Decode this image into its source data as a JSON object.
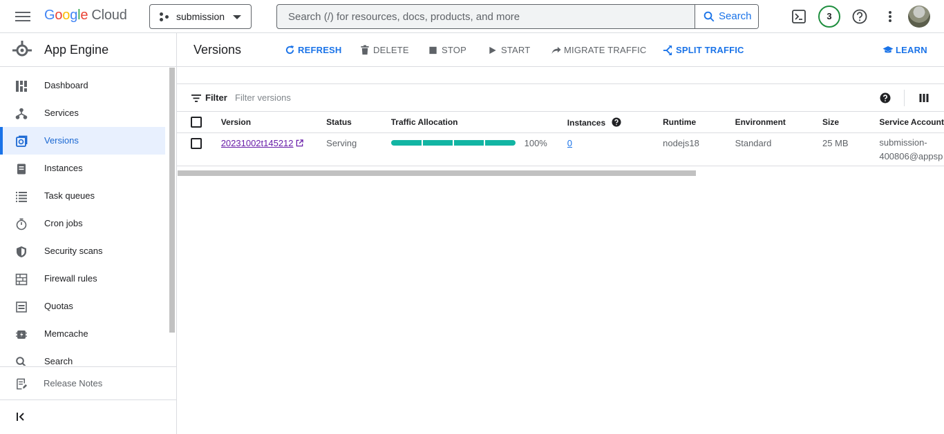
{
  "topbar": {
    "logo_text": "Google",
    "logo_cloud": "Cloud",
    "project_name": "submission",
    "search_placeholder": "Search (/) for resources, docs, products, and more",
    "search_button": "Search",
    "notification_count": "3",
    "icons": [
      "menu-icon",
      "project-dots-icon",
      "search-icon",
      "cloud-shell-icon",
      "help-icon",
      "more-vert-icon",
      "avatar"
    ]
  },
  "sidebar": {
    "product_title": "App Engine",
    "items": [
      {
        "label": "Dashboard",
        "icon": "dashboard-icon"
      },
      {
        "label": "Services",
        "icon": "services-icon"
      },
      {
        "label": "Versions",
        "icon": "versions-icon",
        "active": true
      },
      {
        "label": "Instances",
        "icon": "instances-icon"
      },
      {
        "label": "Task queues",
        "icon": "task-queues-icon"
      },
      {
        "label": "Cron jobs",
        "icon": "cron-jobs-icon"
      },
      {
        "label": "Security scans",
        "icon": "security-scans-icon"
      },
      {
        "label": "Firewall rules",
        "icon": "firewall-rules-icon"
      },
      {
        "label": "Quotas",
        "icon": "quotas-icon"
      },
      {
        "label": "Memcache",
        "icon": "memcache-icon"
      },
      {
        "label": "Search",
        "icon": "search-icon"
      }
    ],
    "release_notes": "Release Notes"
  },
  "toolbar": {
    "title": "Versions",
    "refresh": "REFRESH",
    "delete": "DELETE",
    "stop": "STOP",
    "start": "START",
    "migrate": "MIGRATE TRAFFIC",
    "split": "SPLIT TRAFFIC",
    "learn": "LEARN"
  },
  "filter": {
    "label": "Filter",
    "placeholder": "Filter versions"
  },
  "table": {
    "columns": {
      "version": "Version",
      "status": "Status",
      "traffic": "Traffic Allocation",
      "instances": "Instances",
      "runtime": "Runtime",
      "environment": "Environment",
      "size": "Size",
      "service_account": "Service Account"
    },
    "rows": [
      {
        "version": "20231002t145212",
        "status": "Serving",
        "traffic_fraction": 1.0,
        "traffic_pct": "100%",
        "instances": "0",
        "runtime": "nodejs18",
        "environment": "Standard",
        "size": "25 MB",
        "service_account_1": "submission-",
        "service_account_2": "400806@appsp"
      }
    ]
  },
  "colors": {
    "accent": "#1a73e8",
    "traffic": "#12b5a3",
    "visited_link": "#681da8",
    "notification_ring": "#1e8e3e"
  }
}
